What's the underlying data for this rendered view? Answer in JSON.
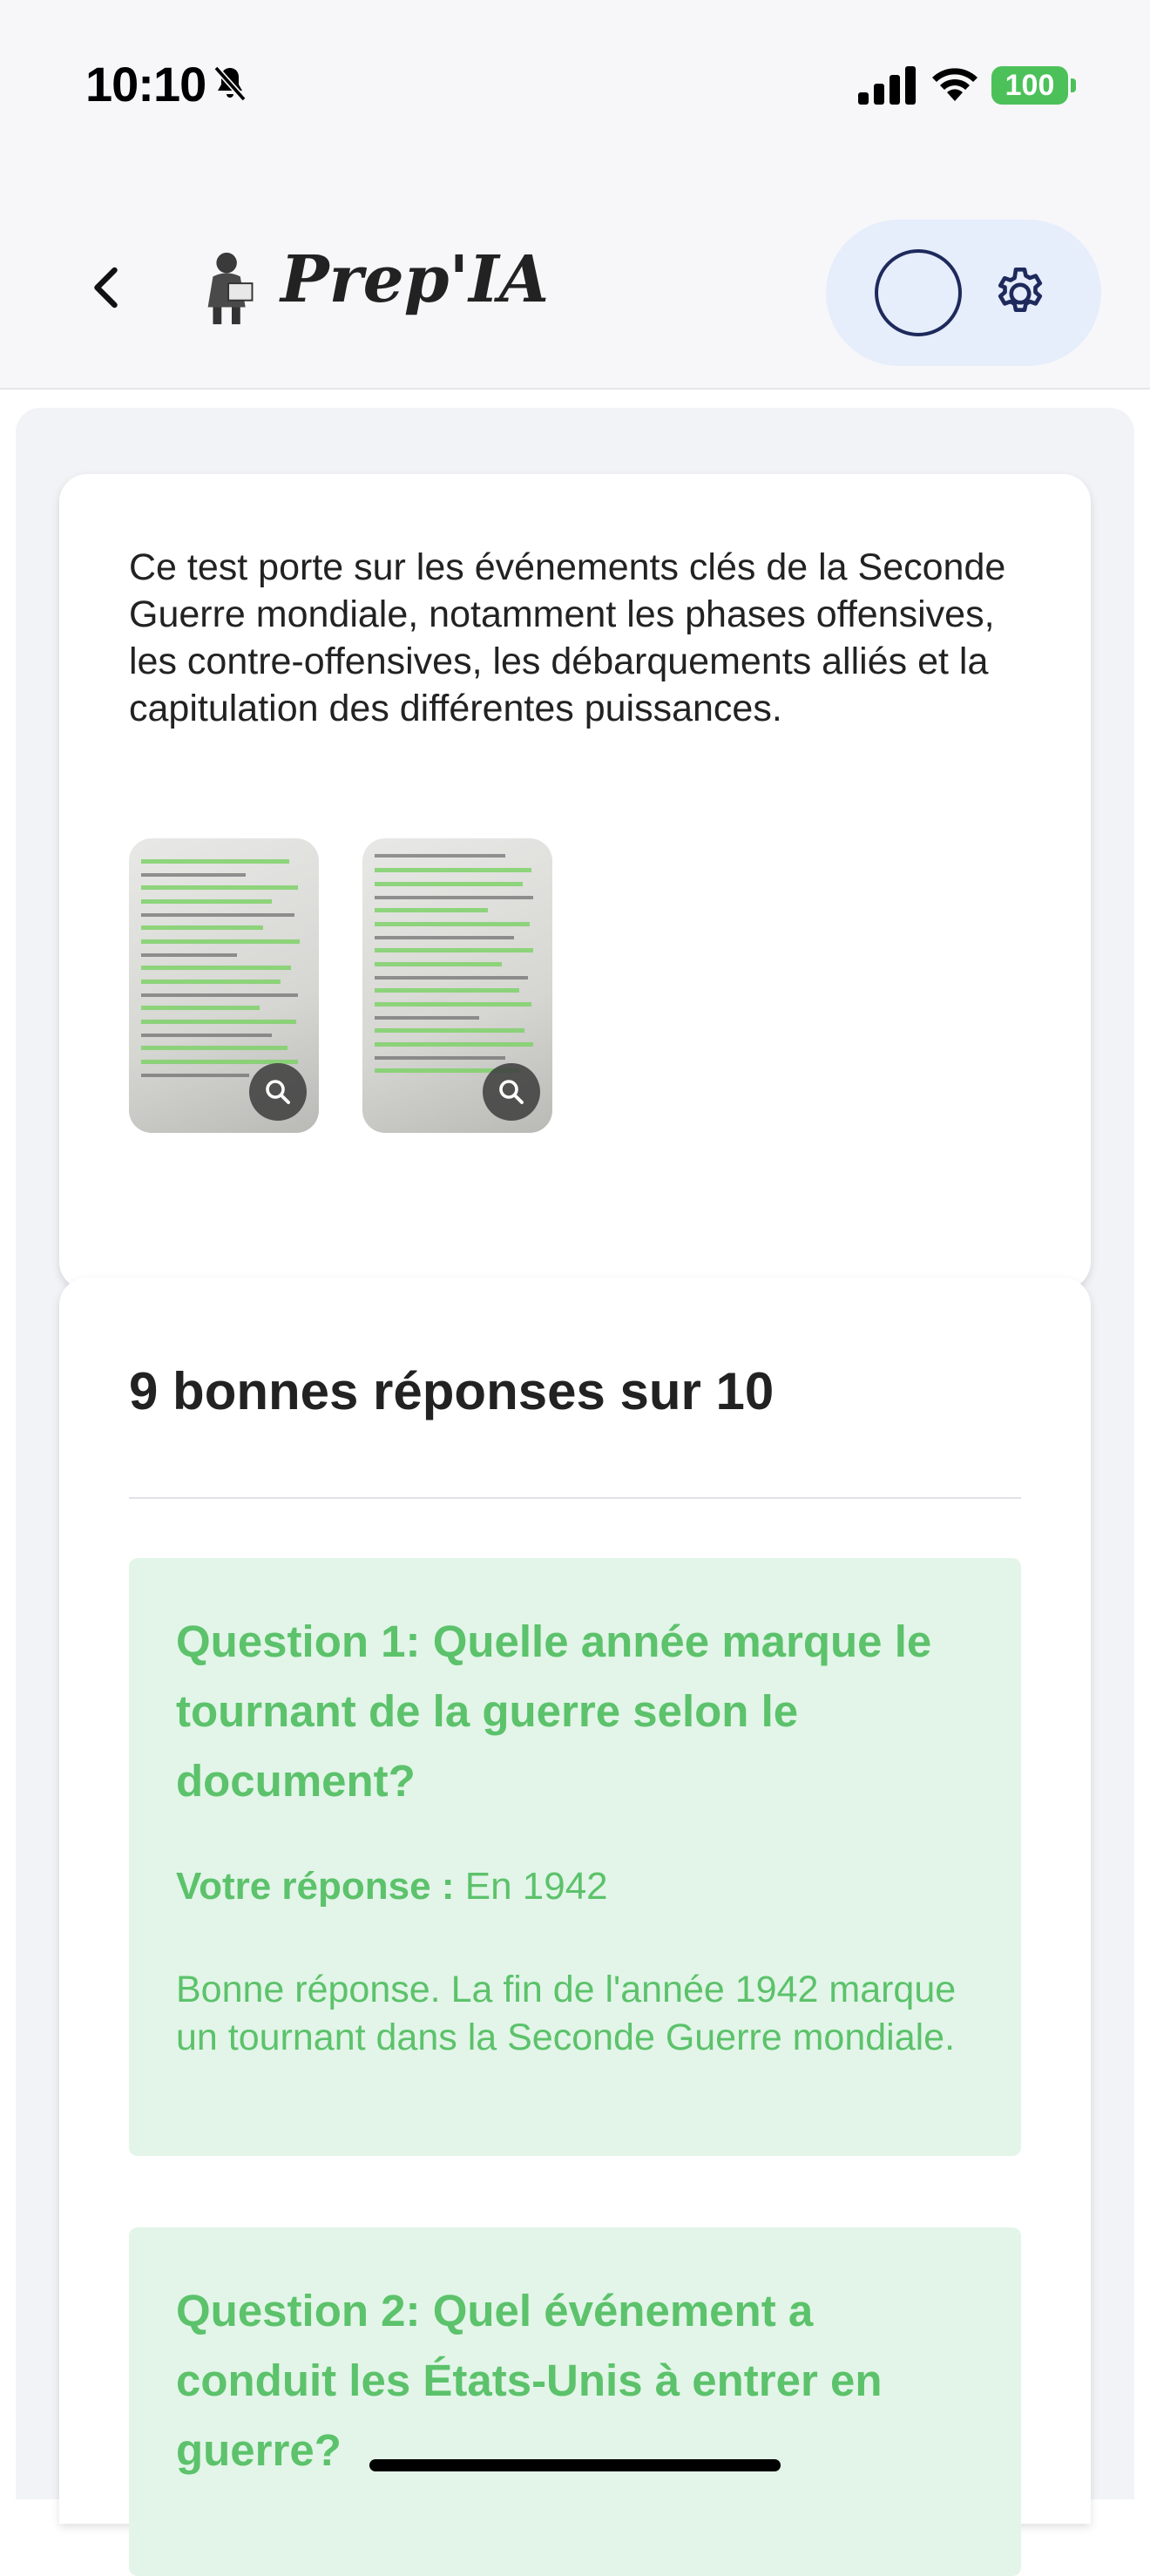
{
  "status_bar": {
    "time": "10:10",
    "battery": "100",
    "icons": [
      "bell-slash-icon",
      "signal-icon",
      "wifi-icon",
      "battery-icon"
    ],
    "battery_color": "#4cc15a"
  },
  "header": {
    "title": "Prep'IA",
    "back_icon": "chevron-left-icon",
    "settings_icon": "gear-icon",
    "pill_color": "#e6edfb"
  },
  "intro": {
    "description": "Ce test porte sur les événements clés de la Seconde Guerre mondiale, notamment les phases offensives, les contre-offensives, les débarquements alliés et la capitulation des différentes puissances.",
    "thumbnails": [
      {
        "icon": "zoom-icon"
      },
      {
        "icon": "zoom-icon"
      }
    ]
  },
  "results": {
    "score": "9 bonnes réponses sur 10",
    "correct_color": "#5cc26b",
    "correct_bg": "#e2f5e8",
    "questions": [
      {
        "title": "Question 1: Quelle année marque le tournant de la guerre selon le document?",
        "answer_label": "Votre réponse :",
        "answer": "En 1942",
        "explanation": "Bonne réponse. La fin de l'année 1942 marque un tournant dans la Seconde Guerre mondiale."
      },
      {
        "title": "Question 2: Quel événement a conduit les États-Unis à entrer en guerre?"
      }
    ]
  }
}
